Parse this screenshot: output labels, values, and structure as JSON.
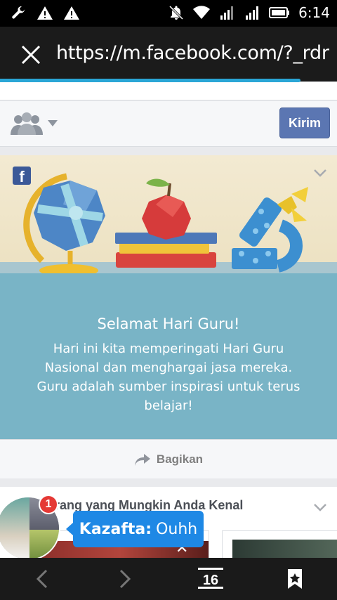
{
  "status_bar": {
    "time": "6:14",
    "left_icons": [
      "wrench-icon",
      "warning-icon",
      "warning-icon"
    ],
    "right_icons": [
      "muted-bell-icon",
      "wifi-icon",
      "signal-icon",
      "signal-icon",
      "battery-icon"
    ]
  },
  "url_bar": {
    "url": "https://m.facebook.com/?_rdr"
  },
  "composer": {
    "submit_label": "Kirim"
  },
  "card": {
    "title": "Selamat Hari Guru!",
    "body": "Hari ini kita memperingati Hari Guru Nasional dan menghargai jasa mereka. Guru adalah sumber inspirasi untuk terus belajar!",
    "share_label": "Bagikan"
  },
  "pymk": {
    "title": "Orang yang Mungkin Anda Kenal"
  },
  "chat_head": {
    "badge_count": "1",
    "sender": "Kazafta:",
    "message": "Ouhh"
  },
  "bottom_bar": {
    "tab_count": "16"
  },
  "colors": {
    "facebook_blue": "#3b5998",
    "teal_card": "#79b4c6",
    "chat_bubble": "#1e88e5",
    "progress": "#2aa6d6"
  }
}
